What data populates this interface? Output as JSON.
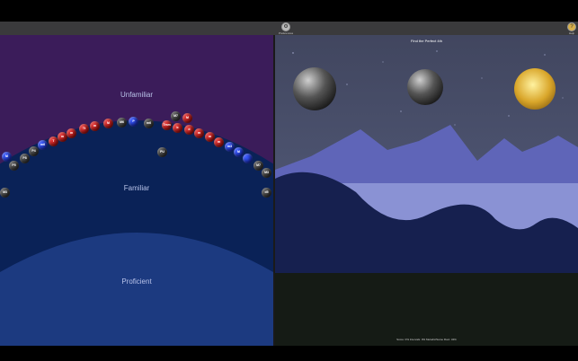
{
  "toolbar": {
    "center_tool_label": "Preferences",
    "right_tool_label": "Help",
    "help_icon": "question-circle-icon",
    "prefs_icon": "gear-icon"
  },
  "left_panel": {
    "zones": [
      "Unfamiliar",
      "Familiar",
      "Proficient"
    ],
    "colors": {
      "unfamiliar": "#3b1c5a",
      "familiar": "#0a2257",
      "proficient": "#1c3a80"
    },
    "balls": [
      {
        "label": "M",
        "color": "blue"
      },
      {
        "label": "P5",
        "color": "gray"
      },
      {
        "label": "P8",
        "color": "gray"
      },
      {
        "label": "P4",
        "color": "gray"
      },
      {
        "label": "m6",
        "color": "blue"
      },
      {
        "label": "T",
        "color": "red"
      },
      {
        "label": "m",
        "color": "red"
      },
      {
        "label": "m",
        "color": "red"
      },
      {
        "label": "Tt",
        "color": "red"
      },
      {
        "label": "m",
        "color": "red"
      },
      {
        "label": "M",
        "color": "red"
      },
      {
        "label": "M6",
        "color": "gray"
      },
      {
        "label": "P",
        "color": "blue"
      },
      {
        "label": "m6",
        "color": "gray"
      },
      {
        "label": "M7",
        "color": "gray"
      },
      {
        "label": "M",
        "color": "red"
      },
      {
        "label": "Tmm",
        "color": "red"
      },
      {
        "label": "b",
        "color": "red"
      },
      {
        "label": "d",
        "color": "red"
      },
      {
        "label": "m",
        "color": "red"
      },
      {
        "label": "m",
        "color": "red"
      },
      {
        "label": "m",
        "color": "red"
      },
      {
        "label": "m3",
        "color": "blue"
      },
      {
        "label": "M",
        "color": "blue"
      },
      {
        "label": "",
        "color": "blue"
      },
      {
        "label": "M7",
        "color": "gray"
      },
      {
        "label": "M3",
        "color": "gray"
      },
      {
        "label": "d5",
        "color": "gray"
      },
      {
        "label": "PU",
        "color": "gray"
      },
      {
        "label": "M3",
        "color": "gray"
      },
      {
        "label": "M2",
        "color": "gray"
      },
      {
        "label": "m2",
        "color": "gray"
      }
    ]
  },
  "right_panel": {
    "title": "Find the Perfect 4th",
    "score_text": "Score: 0%  Intervals: 0%  Melodic/Same Root: 34%",
    "moons": [
      "dark-moon",
      "dark-moon",
      "gold-moon"
    ]
  }
}
